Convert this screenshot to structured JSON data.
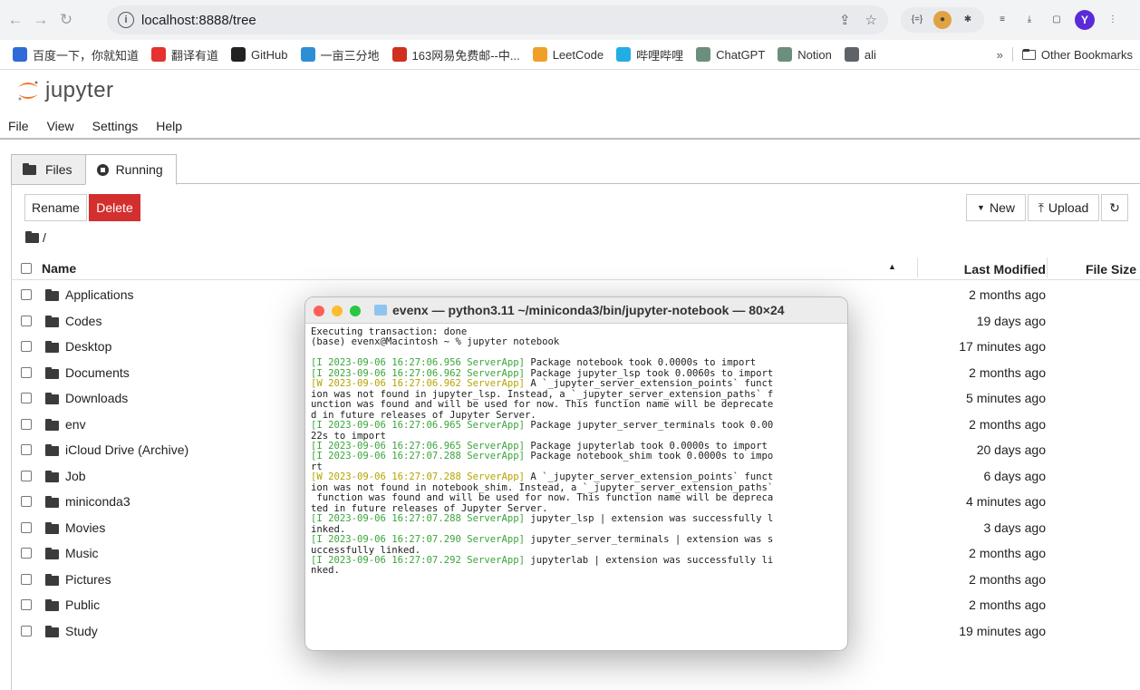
{
  "browser": {
    "url": "localhost:8888/tree",
    "avatar_letter": "Y",
    "bookmarks": [
      {
        "label": "百度一下，你就知道",
        "icon": "baidu-icon",
        "color": "#2f6bd8"
      },
      {
        "label": "翻译有道",
        "icon": "youdao-icon",
        "color": "#e5312f"
      },
      {
        "label": "GitHub",
        "icon": "github-icon",
        "color": "#222222"
      },
      {
        "label": "一亩三分地",
        "icon": "1point3acres-icon",
        "color": "#2c8fd6"
      },
      {
        "label": "163网易免费邮--中...",
        "icon": "netease-icon",
        "color": "#d0301f"
      },
      {
        "label": "LeetCode",
        "icon": "leetcode-icon",
        "color": "#f0a028"
      },
      {
        "label": "哔哩哔哩",
        "icon": "bilibili-icon",
        "color": "#23ade5"
      },
      {
        "label": "ChatGPT",
        "icon": "chatgpt-icon",
        "color": "#6b8e7f"
      },
      {
        "label": "Notion",
        "icon": "chatgpt-icon",
        "color": "#6b8e7f"
      },
      {
        "label": "ali",
        "icon": "folder-icon",
        "color": "#5f6368"
      }
    ],
    "more": "»",
    "other_bookmarks": "Other Bookmarks"
  },
  "jupyter": {
    "logo_text": "jupyter",
    "menu": [
      "File",
      "View",
      "Settings",
      "Help"
    ],
    "tabs": [
      {
        "label": "Files"
      },
      {
        "label": "Running"
      }
    ],
    "buttons": {
      "rename": "Rename",
      "delete": "Delete",
      "new": "New",
      "upload": "Upload"
    },
    "breadcrumb": "/",
    "columns": {
      "name": "Name",
      "modified": "Last Modified",
      "size": "File Size"
    },
    "files": [
      {
        "name": "Applications",
        "modified": "2 months ago"
      },
      {
        "name": "Codes",
        "modified": "19 days ago"
      },
      {
        "name": "Desktop",
        "modified": "17 minutes ago"
      },
      {
        "name": "Documents",
        "modified": "2 months ago"
      },
      {
        "name": "Downloads",
        "modified": "5 minutes ago"
      },
      {
        "name": "env",
        "modified": "2 months ago"
      },
      {
        "name": "iCloud Drive (Archive)",
        "modified": "20 days ago"
      },
      {
        "name": "Job",
        "modified": "6 days ago"
      },
      {
        "name": "miniconda3",
        "modified": "4 minutes ago"
      },
      {
        "name": "Movies",
        "modified": "3 days ago"
      },
      {
        "name": "Music",
        "modified": "2 months ago"
      },
      {
        "name": "Pictures",
        "modified": "2 months ago"
      },
      {
        "name": "Public",
        "modified": "2 months ago"
      },
      {
        "name": "Study",
        "modified": "19 minutes ago"
      }
    ]
  },
  "terminal": {
    "title": "evenx — python3.11 ~/miniconda3/bin/jupyter-notebook — 80×24",
    "lines": [
      {
        "t": "Executing transaction: done"
      },
      {
        "t": "(base) evenx@Macintosh ~ % jupyter notebook"
      },
      {
        "t": ""
      },
      {
        "p": "[I 2023-09-06 16:27:06.956 ServerApp]",
        "c": "g",
        "t": " Package notebook took 0.0000s to import"
      },
      {
        "p": "[I 2023-09-06 16:27:06.962 ServerApp]",
        "c": "g",
        "t": " Package jupyter_lsp took 0.0060s to import"
      },
      {
        "p": "[W 2023-09-06 16:27:06.962 ServerApp]",
        "c": "y",
        "t": " A `_jupyter_server_extension_points` funct"
      },
      {
        "t": "ion was not found in jupyter_lsp. Instead, a `_jupyter_server_extension_paths` f"
      },
      {
        "t": "unction was found and will be used for now. This function name will be deprecate"
      },
      {
        "t": "d in future releases of Jupyter Server."
      },
      {
        "p": "[I 2023-09-06 16:27:06.965 ServerApp]",
        "c": "g",
        "t": " Package jupyter_server_terminals took 0.00"
      },
      {
        "t": "22s to import"
      },
      {
        "p": "[I 2023-09-06 16:27:06.965 ServerApp]",
        "c": "g",
        "t": " Package jupyterlab took 0.0000s to import"
      },
      {
        "p": "[I 2023-09-06 16:27:07.288 ServerApp]",
        "c": "g",
        "t": " Package notebook_shim took 0.0000s to impo"
      },
      {
        "t": "rt"
      },
      {
        "p": "[W 2023-09-06 16:27:07.288 ServerApp]",
        "c": "y",
        "t": " A `_jupyter_server_extension_points` funct"
      },
      {
        "t": "ion was not found in notebook_shim. Instead, a `_jupyter_server_extension_paths`"
      },
      {
        "t": " function was found and will be used for now. This function name will be depreca"
      },
      {
        "t": "ted in future releases of Jupyter Server."
      },
      {
        "p": "[I 2023-09-06 16:27:07.288 ServerApp]",
        "c": "g",
        "t": " jupyter_lsp | extension was successfully l"
      },
      {
        "t": "inked."
      },
      {
        "p": "[I 2023-09-06 16:27:07.290 ServerApp]",
        "c": "g",
        "t": " jupyter_server_terminals | extension was s"
      },
      {
        "t": "uccessfully linked."
      },
      {
        "p": "[I 2023-09-06 16:27:07.292 ServerApp]",
        "c": "g",
        "t": " jupyterlab | extension was successfully li"
      },
      {
        "t": "nked."
      }
    ]
  }
}
